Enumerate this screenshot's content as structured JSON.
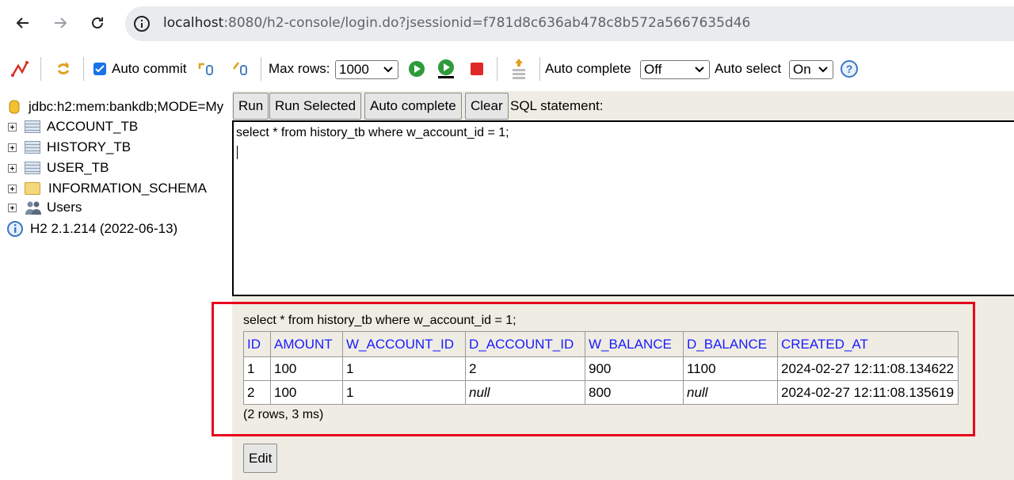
{
  "browser": {
    "url_host": "localhost",
    "url_rest": ":8080/h2-console/login.do?jsessionid=f781d8c636ab478c8b572a5667635d46"
  },
  "toolbar": {
    "auto_commit_label": "Auto commit",
    "auto_commit_checked": true,
    "max_rows_label": "Max rows:",
    "max_rows_value": "1000",
    "auto_complete_label": "Auto complete",
    "auto_complete_value": "Off",
    "auto_select_label": "Auto select",
    "auto_select_value": "On",
    "help_glyph": "?"
  },
  "tree": {
    "connection": "jdbc:h2:mem:bankdb;MODE=My",
    "items": [
      {
        "label": "ACCOUNT_TB",
        "icon": "table-icon"
      },
      {
        "label": "HISTORY_TB",
        "icon": "table-icon"
      },
      {
        "label": "USER_TB",
        "icon": "table-icon"
      },
      {
        "label": "INFORMATION_SCHEMA",
        "icon": "folder-icon"
      },
      {
        "label": "Users",
        "icon": "users-icon"
      }
    ],
    "version": "H2 2.1.214 (2022-06-13)"
  },
  "query": {
    "buttons": {
      "run": "Run",
      "run_selected": "Run Selected",
      "auto_complete": "Auto complete",
      "clear": "Clear"
    },
    "sql_label": "SQL statement:",
    "sql_text": "select * from history_tb where w_account_id = 1;"
  },
  "result": {
    "sql": "select * from history_tb where w_account_id = 1;",
    "columns": [
      "ID",
      "AMOUNT",
      "W_ACCOUNT_ID",
      "D_ACCOUNT_ID",
      "W_BALANCE",
      "D_BALANCE",
      "CREATED_AT"
    ],
    "rows": [
      [
        "1",
        "100",
        "1",
        "2",
        "900",
        "1100",
        "2024-02-27 12:11:08.134622"
      ],
      [
        "2",
        "100",
        "1",
        "null",
        "800",
        "null",
        "2024-02-27 12:11:08.135619"
      ]
    ],
    "summary": "(2 rows, 3 ms)",
    "edit_label": "Edit"
  },
  "colors": {
    "highlight": "#e8001c",
    "header_text": "#1a1aff",
    "panel_bg": "#efede3"
  }
}
